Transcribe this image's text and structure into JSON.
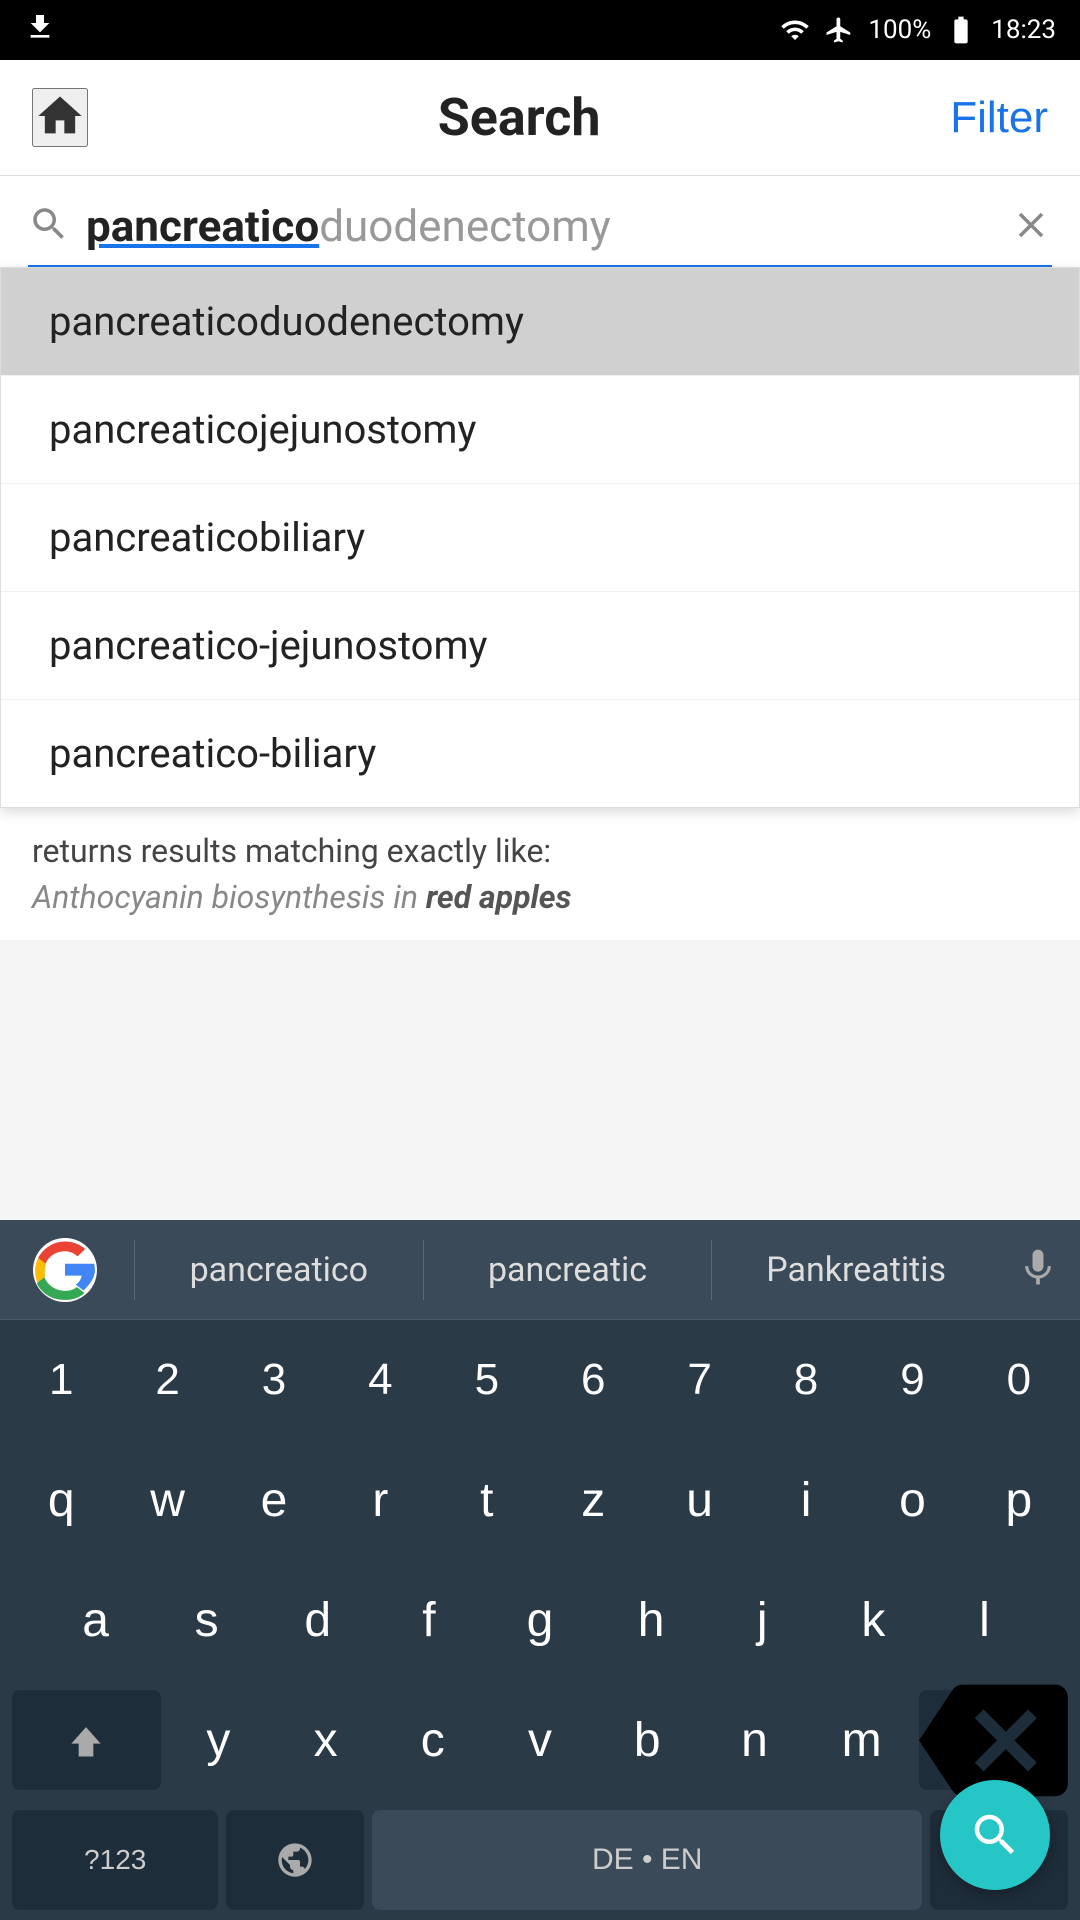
{
  "statusBar": {
    "battery": "100%",
    "time": "18:23"
  },
  "header": {
    "title": "Search",
    "filterLabel": "Filter"
  },
  "searchInput": {
    "typedText": "pancreatico",
    "remainingText": "duodenectomy",
    "clearLabel": "×"
  },
  "autocomplete": {
    "items": [
      "pancreaticoduodenectomy",
      "pancreaticojejunostomy",
      "pancreaticobiliary",
      "pancreatico-jejunostomy",
      "pancreatico-biliary"
    ]
  },
  "belowDropdown": {
    "description": "returns results matching exactly like:",
    "exampleNormal": "Anthocyanin biosynthesis in ",
    "exampleBold": "red apples"
  },
  "keyboard": {
    "suggestions": [
      "pancreatico",
      "pancreatic",
      "Pankreatitis"
    ],
    "rows": {
      "numbers": [
        "1",
        "2",
        "3",
        "4",
        "5",
        "6",
        "7",
        "8",
        "9",
        "0"
      ],
      "row1": [
        "q",
        "w",
        "e",
        "r",
        "t",
        "z",
        "u",
        "i",
        "o",
        "p"
      ],
      "row2": [
        "a",
        "s",
        "d",
        "f",
        "g",
        "h",
        "j",
        "k",
        "l"
      ],
      "row3": [
        "y",
        "x",
        "c",
        "v",
        "b",
        "n",
        "m"
      ],
      "specialLeft": "?123",
      "spaceLabel": "DE • EN",
      "periodLabel": "."
    }
  }
}
